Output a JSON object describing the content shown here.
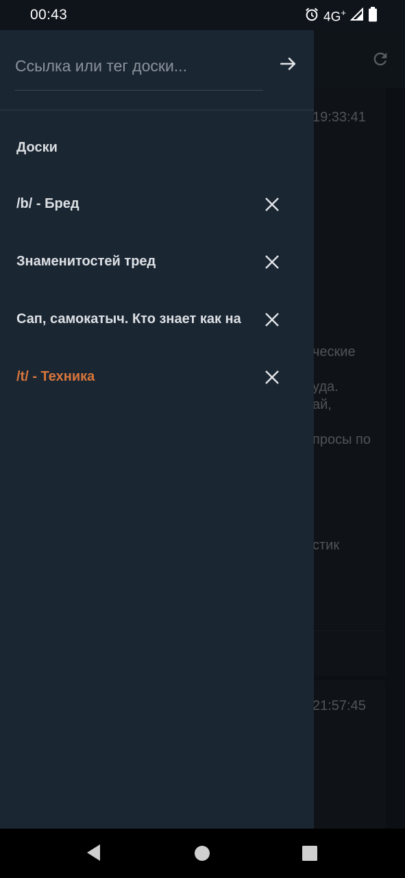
{
  "status_bar": {
    "time": "00:43",
    "network": "4G",
    "network_sup": "+",
    "icons": [
      "alarm-icon",
      "signal-icon",
      "battery-icon"
    ]
  },
  "background": {
    "times": [
      "19:33:41",
      "21:57:45"
    ],
    "fragments": [
      "ческие",
      "уда.",
      "ай,",
      "просы по",
      "стик"
    ]
  },
  "drawer": {
    "search": {
      "placeholder": "Ссылка или тег доски...",
      "value": "",
      "go_icon": "arrow-right-icon"
    },
    "section_title": "Доски",
    "boards": [
      {
        "label": "/b/ - Бред",
        "active": false
      },
      {
        "label": "Знаменитостей тред",
        "active": false
      },
      {
        "label": "Сап, самокатыч.  Кто знает как на",
        "active": false
      },
      {
        "label": "/t/ - Техника",
        "active": true
      }
    ]
  },
  "colors": {
    "drawer_bg": "#1b2633",
    "active_accent": "#d9763a",
    "text_primary": "#dde1e5",
    "placeholder": "#8b939b"
  },
  "nav_bar": {
    "buttons": [
      "back-icon",
      "home-icon",
      "recents-icon"
    ]
  }
}
